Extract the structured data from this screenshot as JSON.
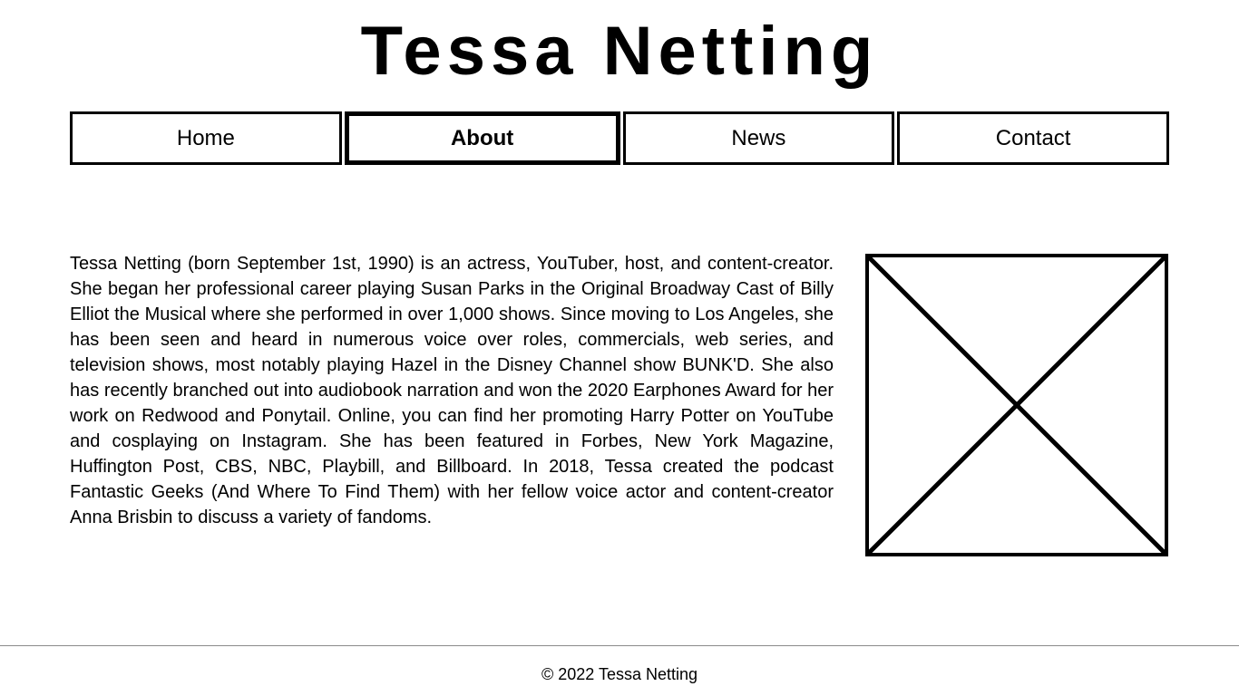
{
  "header": {
    "title": "Tessa Netting"
  },
  "nav": {
    "items": [
      {
        "label": "Home",
        "active": false
      },
      {
        "label": "About",
        "active": true
      },
      {
        "label": "News",
        "active": false
      },
      {
        "label": "Contact",
        "active": false
      }
    ]
  },
  "main": {
    "bio": "Tessa Netting (born September 1st, 1990) is an actress, YouTuber, host, and content-creator. She began her professional career playing Susan Parks in the Original Broadway Cast of Billy Elliot the Musical where she performed in over 1,000 shows. Since moving to Los Angeles, she has been seen and heard in numerous voice over roles, commercials, web series, and television shows, most notably playing Hazel in the Disney Channel show BUNK'D. She also has recently branched out into audiobook narration and won the 2020 Earphones Award for her work on Redwood and Ponytail. Online, you can find her promoting Harry Potter on YouTube and cosplaying on Instagram. She has been featured in Forbes, New York Magazine, Huffington Post, CBS, NBC, Playbill, and Billboard. In 2018, Tessa created the podcast Fantastic Geeks (And Where To Find Them) with her fellow voice actor and content-creator Anna Brisbin to discuss a variety of fandoms.",
    "image_icon": "image-placeholder-icon"
  },
  "footer": {
    "copyright": "© 2022 Tessa Netting"
  },
  "colors": {
    "text": "#000000",
    "background": "#ffffff",
    "footer_rule": "#8a8a8a"
  }
}
